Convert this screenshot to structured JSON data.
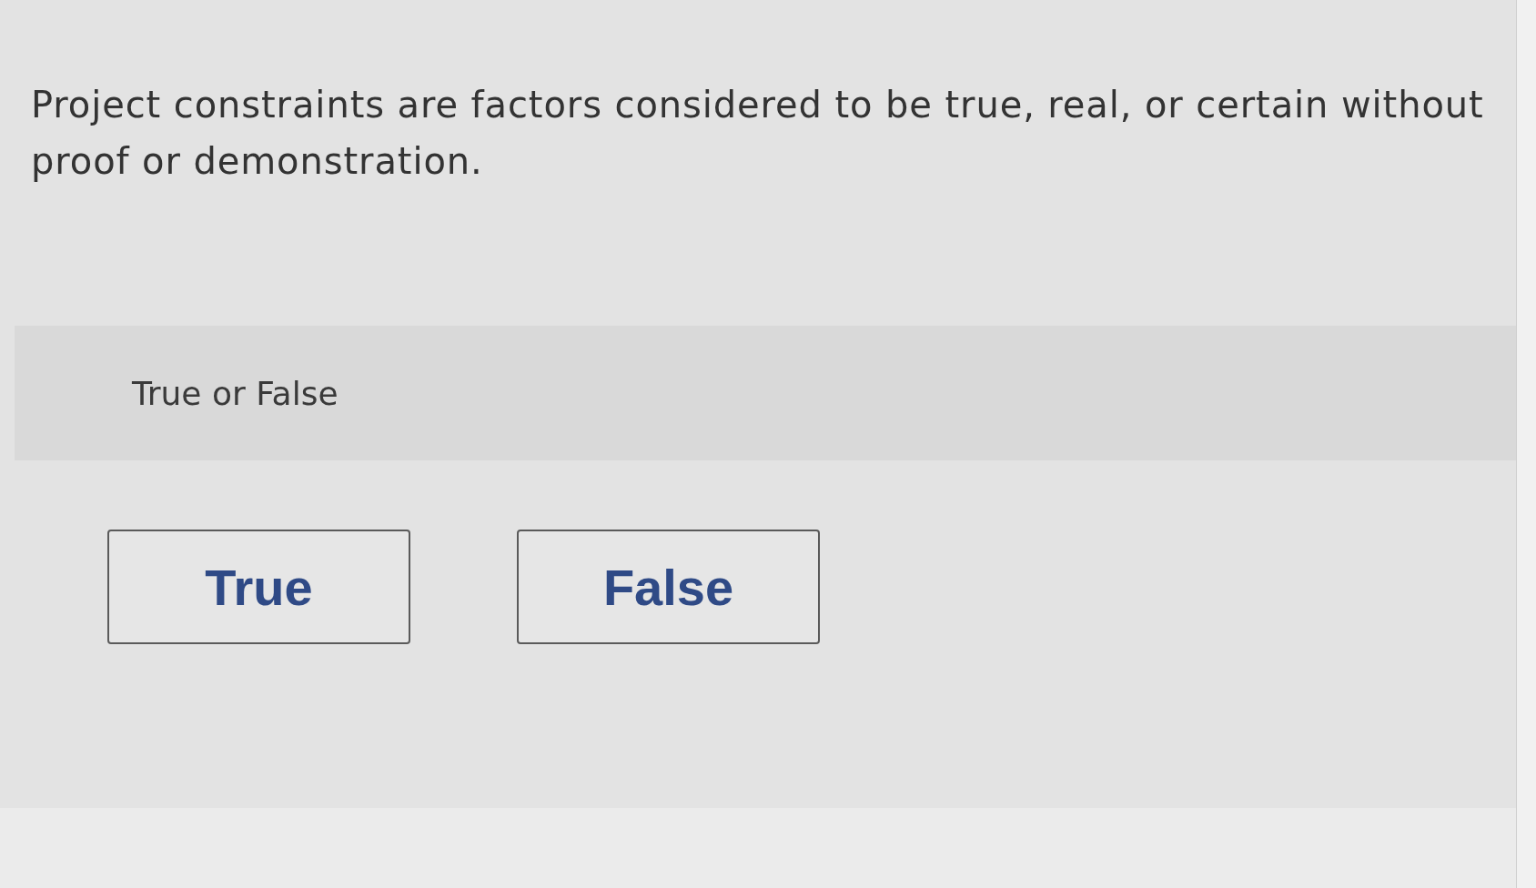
{
  "question": {
    "text": "Project constraints are factors considered to be true, real, or certain without proof or demonstration."
  },
  "answer_panel": {
    "label": "True or False"
  },
  "options": [
    {
      "label": "True",
      "selected": false
    },
    {
      "label": "False",
      "selected": false
    }
  ]
}
